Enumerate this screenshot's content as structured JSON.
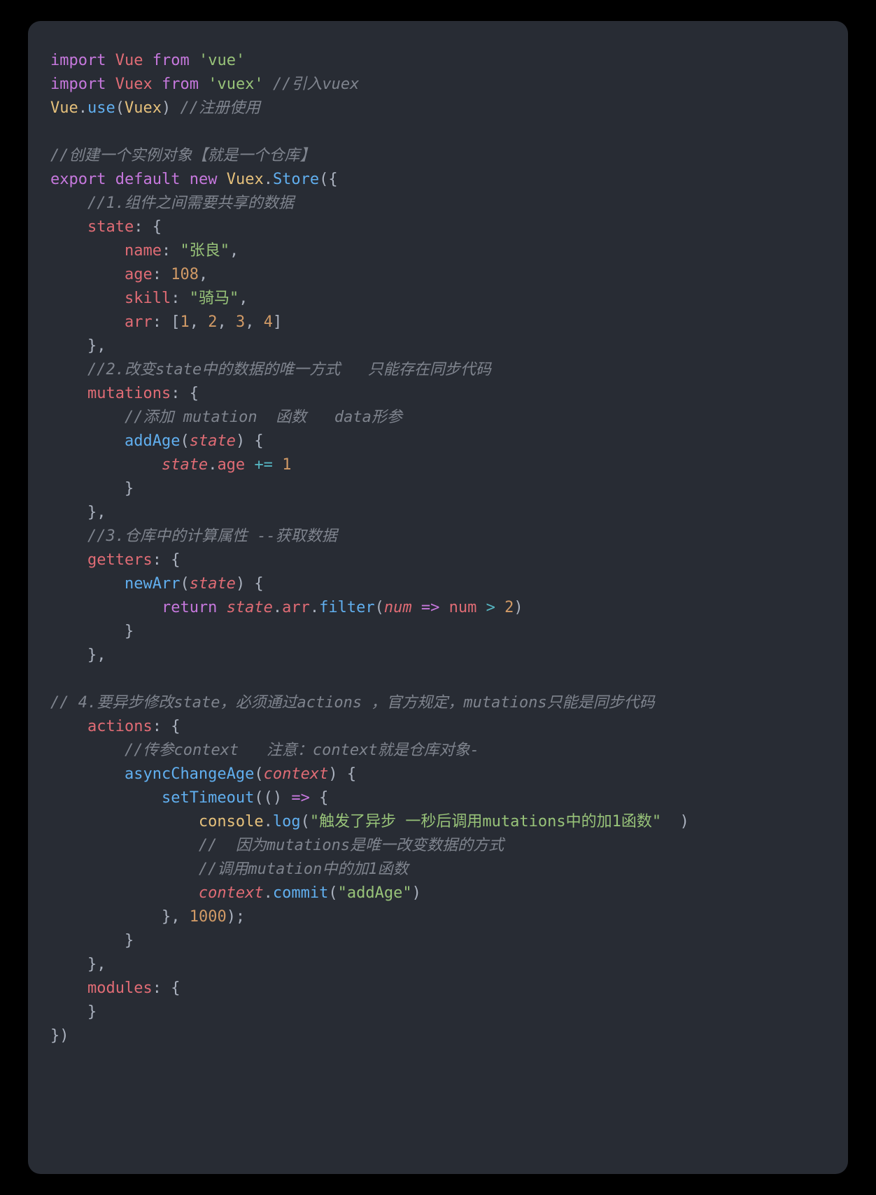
{
  "code": {
    "l1": {
      "kw1": "import",
      "id": "Vue",
      "kw2": "from",
      "str": "'vue'"
    },
    "l2": {
      "kw1": "import",
      "id": "Vuex",
      "kw2": "from",
      "str": "'vuex'",
      "cmt": "//引入vuex"
    },
    "l3": {
      "cls": "Vue",
      "fn": "use",
      "arg": "Vuex",
      "cmt": "//注册使用"
    },
    "l5": {
      "cmt": "//创建一个实例对象【就是一个仓库】"
    },
    "l6": {
      "kw1": "export",
      "kw2": "default",
      "kw3": "new",
      "cls": "Vuex",
      "fn": "Store"
    },
    "l7": {
      "cmt": "//1.组件之间需要共享的数据"
    },
    "l8": {
      "key": "state"
    },
    "l9": {
      "key": "name",
      "val": "\"张良\""
    },
    "l10": {
      "key": "age",
      "val": "108"
    },
    "l11": {
      "key": "skill",
      "val": "\"骑马\""
    },
    "l12": {
      "key": "arr",
      "v1": "1",
      "v2": "2",
      "v3": "3",
      "v4": "4"
    },
    "l14": {
      "cmt": "//2.改变state中的数据的唯一方式   只能存在同步代码"
    },
    "l15": {
      "key": "mutations"
    },
    "l16": {
      "cmt": "//添加 mutation  函数   data形参"
    },
    "l17": {
      "fn": "addAge",
      "arg": "state"
    },
    "l18": {
      "obj": "state",
      "prop": "age",
      "op": "+=",
      "val": "1"
    },
    "l21": {
      "cmt": "//3.仓库中的计算属性 --获取数据"
    },
    "l22": {
      "key": "getters"
    },
    "l23": {
      "fn": "newArr",
      "arg": "state"
    },
    "l24": {
      "kw": "return",
      "obj": "state",
      "prop": "arr",
      "fn": "filter",
      "p": "num",
      "op": "=>",
      "p2": "num",
      "cmp": ">",
      "val": "2"
    },
    "l28": {
      "cmt": "// 4.要异步修改state，必须通过actions ，官方规定，mutations只能是同步代码"
    },
    "l29": {
      "key": "actions"
    },
    "l30": {
      "cmt": "//传参context   注意：context就是仓库对象-"
    },
    "l31": {
      "fn": "asyncChangeAge",
      "arg": "context"
    },
    "l32": {
      "fn": "setTimeout",
      "op": "=>"
    },
    "l33": {
      "obj": "console",
      "fn": "log",
      "str": "\"触发了异步 一秒后调用mutations中的加1函数\""
    },
    "l34": {
      "cmt": "//  因为mutations是唯一改变数据的方式"
    },
    "l35": {
      "cmt": "//调用mutation中的加1函数"
    },
    "l36": {
      "obj": "context",
      "fn": "commit",
      "str": "\"addAge\""
    },
    "l37": {
      "val": "1000"
    },
    "l40": {
      "key": "modules"
    }
  }
}
